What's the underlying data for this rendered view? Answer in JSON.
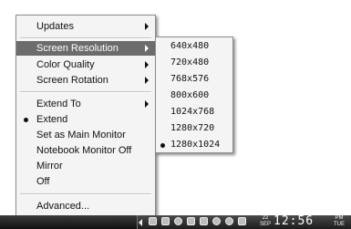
{
  "main_menu": {
    "items": [
      {
        "label": "Updates",
        "submenu": true
      },
      {
        "label": "Screen Resolution",
        "submenu": true,
        "highlighted": true
      },
      {
        "label": "Color Quality",
        "submenu": true
      },
      {
        "label": "Screen Rotation",
        "submenu": true
      },
      {
        "label": "Extend To",
        "submenu": true
      },
      {
        "label": "Extend",
        "checked": true
      },
      {
        "label": "Set as Main Monitor"
      },
      {
        "label": "Notebook Monitor Off"
      },
      {
        "label": "Mirror"
      },
      {
        "label": "Off"
      },
      {
        "label": "Advanced..."
      }
    ]
  },
  "resolution_menu": {
    "items": [
      {
        "label": "640x480"
      },
      {
        "label": "720x480"
      },
      {
        "label": "768x576"
      },
      {
        "label": "800x600"
      },
      {
        "label": "1024x768"
      },
      {
        "label": "1280x720"
      },
      {
        "label": "1280x1024",
        "checked": true
      }
    ]
  },
  "taskbar": {
    "date_top": "22",
    "date_bottom": "SEP",
    "time": "12:56",
    "ampm_top": "PM",
    "ampm_bottom": "TUE"
  },
  "colors": {
    "highlight": "#6c6c6c",
    "menu_bg": "#f4f4f4",
    "taskbar": "#111111"
  }
}
